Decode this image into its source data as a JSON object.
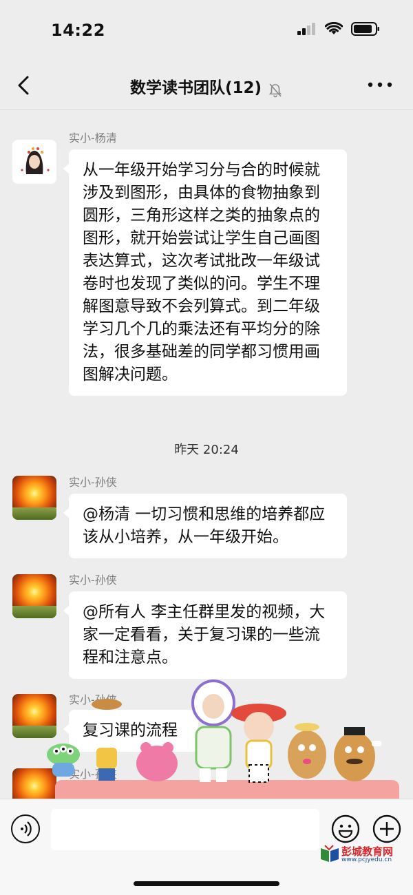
{
  "status_bar": {
    "time": "14:22"
  },
  "header": {
    "title": "数学读书团队(12)"
  },
  "messages": [
    {
      "sender": "实小-杨清",
      "text": "从一年级开始学习分与合的时候就涉及到图形，由具体的食物抽象到圆形，三角形这样之类的抽象点的图形，就开始尝试让学生自己画图表达算式，这次考试批改一年级试卷时也发现了类似的问。学生不理解图意导致不会列算式。到二年级学习几个几的乘法还有平均分的除法，很多基础差的同学都习惯用画图解决问题。"
    },
    {
      "sender": "实小-孙侠",
      "text": "@杨清 一切习惯和思维的培养都应该从小培养，从一年级开始。"
    },
    {
      "sender": "实小-孙侠",
      "text": "@所有人 李主任群里发的视频，大家一定看看，关于复习课的一些流程和注意点。"
    },
    {
      "sender": "实小-孙侠",
      "text": "复习课的流程"
    },
    {
      "sender": "实小-孙侠"
    }
  ],
  "timestamp": "昨天 20:24",
  "input": {
    "placeholder": ""
  },
  "watermark": {
    "title": "彭城教育网",
    "url": "www.pcjyedu.cn"
  }
}
